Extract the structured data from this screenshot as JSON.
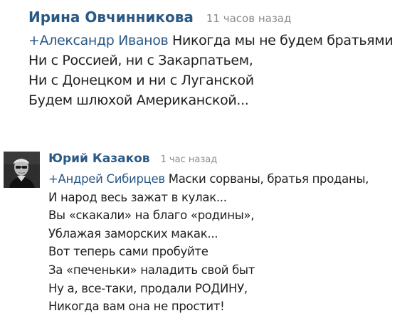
{
  "comments": [
    {
      "author": "Ирина Овчинникова",
      "time": "11 часов назад",
      "reply_to": "+Александр Иванов",
      "first_line_rest": " Никогда мы не будем братьями",
      "lines": [
        "Ни с Россией, ни с Закарпатьем,",
        "Ни с Донецком и ни с Луганской",
        "Будем шлюхой Американской..."
      ]
    },
    {
      "author": "Юрий Казаков",
      "time": "1 час назад",
      "avatar_icon": "user-avatar-photo",
      "reply_to": "+Андрей Сибирцев",
      "first_line_rest": " Маски сорваны, братья проданы,",
      "lines": [
        "И народ весь зажат в кулак...",
        "Вы «скакали» на благо «родины»,",
        "Ублажая заморских макак...",
        "Вот теперь сами пробуйте",
        "За «печеньки» наладить свой быт",
        "Ну а, все-таки,  продали РОДИНУ,",
        "Никогда  вам она не простит!"
      ]
    }
  ],
  "colors": {
    "link": "#2a5885",
    "time": "#8a8a8a",
    "text": "#1f1f1f"
  }
}
